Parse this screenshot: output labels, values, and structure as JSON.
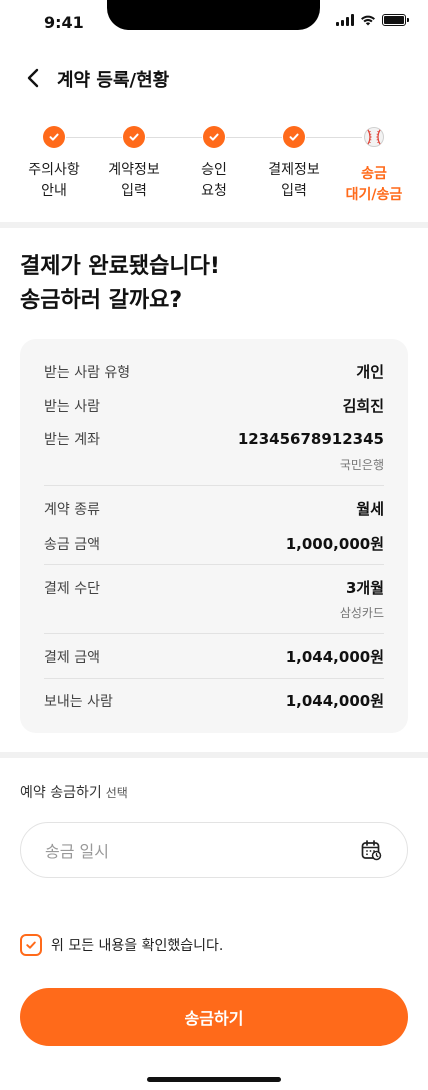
{
  "status_bar": {
    "time": "9:41"
  },
  "header": {
    "title": "계약 등록/현황"
  },
  "stepper": {
    "steps": [
      {
        "label": "주의사항\n안내",
        "state": "done"
      },
      {
        "label": "계약정보\n입력",
        "state": "done"
      },
      {
        "label": "승인\n요청",
        "state": "done"
      },
      {
        "label": "결제정보\n입력",
        "state": "done"
      },
      {
        "label": "송금\n대기/송금",
        "state": "active"
      }
    ]
  },
  "headline": {
    "line1": "결제가 완료됐습니다!",
    "line2": "송금하러 갈까요?"
  },
  "summary": {
    "recipient_type": {
      "label": "받는 사람 유형",
      "value": "개인"
    },
    "recipient": {
      "label": "받는 사람",
      "value": "김희진"
    },
    "account": {
      "label": "받는 계좌",
      "value": "12345678912345",
      "bank": "국민은행"
    },
    "contract_type": {
      "label": "계약 종류",
      "value": "월세"
    },
    "transfer_amount": {
      "label": "송금 금액",
      "value": "1,000,000원"
    },
    "payment_method": {
      "label": "결제 수단",
      "value": "3개월",
      "card": "삼성카드"
    },
    "payment_amount": {
      "label": "결제 금액",
      "value": "1,044,000원"
    },
    "sender": {
      "label": "보내는 사람",
      "value": "1,044,000원"
    }
  },
  "reservation": {
    "label": "예약 송금하기",
    "optional": "선택",
    "placeholder": "송금 일시"
  },
  "agreement": {
    "text": "위 모든 내용을 확인했습니다.",
    "checked": true
  },
  "cta": {
    "label": "송금하기"
  },
  "colors": {
    "accent": "#ff6a1a",
    "card_bg": "#f6f6f6",
    "divider": "#f1f1f1"
  },
  "icons": {
    "back": "chevron-left-icon",
    "step_done": "check-icon",
    "step_active": "baseball-icon",
    "calendar": "calendar-icon",
    "checkbox": "checkbox-checked-icon"
  }
}
